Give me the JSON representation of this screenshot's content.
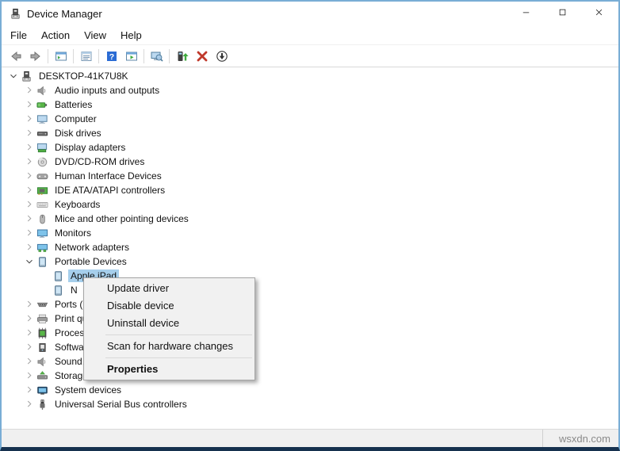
{
  "window": {
    "title": "Device Manager",
    "controls": [
      {
        "name": "minimize",
        "icon": "minimize"
      },
      {
        "name": "maximize",
        "icon": "maximize"
      },
      {
        "name": "close",
        "icon": "close"
      }
    ]
  },
  "menu_bar": {
    "items": [
      "File",
      "Action",
      "View",
      "Help"
    ]
  },
  "toolbar": {
    "items": [
      {
        "type": "button",
        "icon": "back-arrow"
      },
      {
        "type": "button",
        "icon": "forward-arrow"
      },
      {
        "type": "separator"
      },
      {
        "type": "button",
        "icon": "console-tree"
      },
      {
        "type": "separator"
      },
      {
        "type": "button",
        "icon": "properties-window"
      },
      {
        "type": "separator"
      },
      {
        "type": "button",
        "icon": "help"
      },
      {
        "type": "button",
        "icon": "action-pane"
      },
      {
        "type": "separator"
      },
      {
        "type": "button",
        "icon": "scan-computer"
      },
      {
        "type": "separator"
      },
      {
        "type": "button",
        "icon": "update-driver"
      },
      {
        "type": "button",
        "icon": "uninstall-x"
      },
      {
        "type": "button",
        "icon": "disable-down"
      }
    ]
  },
  "tree": {
    "items": [
      {
        "label": "DESKTOP-41K7U8K",
        "icon": "device-manager",
        "level": 0,
        "expander": "expanded",
        "selected": false
      },
      {
        "label": "Audio inputs and outputs",
        "icon": "audio",
        "level": 1,
        "expander": "collapsed",
        "selected": false
      },
      {
        "label": "Batteries",
        "icon": "battery",
        "level": 1,
        "expander": "collapsed",
        "selected": false
      },
      {
        "label": "Computer",
        "icon": "computer",
        "level": 1,
        "expander": "collapsed",
        "selected": false
      },
      {
        "label": "Disk drives",
        "icon": "disk-drive",
        "level": 1,
        "expander": "collapsed",
        "selected": false
      },
      {
        "label": "Display adapters",
        "icon": "display-adapter",
        "level": 1,
        "expander": "collapsed",
        "selected": false
      },
      {
        "label": "DVD/CD-ROM drives",
        "icon": "dvd-drive",
        "level": 1,
        "expander": "collapsed",
        "selected": false
      },
      {
        "label": "Human Interface Devices",
        "icon": "hid",
        "level": 1,
        "expander": "collapsed",
        "selected": false
      },
      {
        "label": "IDE ATA/ATAPI controllers",
        "icon": "ide-controller",
        "level": 1,
        "expander": "collapsed",
        "selected": false
      },
      {
        "label": "Keyboards",
        "icon": "keyboard",
        "level": 1,
        "expander": "collapsed",
        "selected": false
      },
      {
        "label": "Mice and other pointing devices",
        "icon": "mouse",
        "level": 1,
        "expander": "collapsed",
        "selected": false
      },
      {
        "label": "Monitors",
        "icon": "monitor",
        "level": 1,
        "expander": "collapsed",
        "selected": false
      },
      {
        "label": "Network adapters",
        "icon": "network-adapter",
        "level": 1,
        "expander": "collapsed",
        "selected": false
      },
      {
        "label": "Portable Devices",
        "icon": "portable-device",
        "level": 1,
        "expander": "expanded",
        "selected": false
      },
      {
        "label": "Apple iPad",
        "icon": "portable-device",
        "level": 2,
        "expander": "none",
        "selected": true
      },
      {
        "label": "N",
        "icon": "portable-device",
        "level": 2,
        "expander": "none",
        "selected": false
      },
      {
        "label": "Ports (COM & LPT)",
        "icon": "serial-port",
        "level": 1,
        "expander": "collapsed",
        "selected": false
      },
      {
        "label": "Print queues",
        "icon": "printer",
        "level": 1,
        "expander": "collapsed",
        "selected": false
      },
      {
        "label": "Processors",
        "icon": "processor",
        "level": 1,
        "expander": "collapsed",
        "selected": false
      },
      {
        "label": "Software devices",
        "icon": "software-device",
        "level": 1,
        "expander": "collapsed",
        "selected": false
      },
      {
        "label": "Sound, video and game controllers",
        "icon": "sound",
        "level": 1,
        "expander": "collapsed",
        "selected": false
      },
      {
        "label": "Storage controllers",
        "icon": "storage-controller",
        "level": 1,
        "expander": "collapsed",
        "selected": false
      },
      {
        "label": "System devices",
        "icon": "system-device",
        "level": 1,
        "expander": "collapsed",
        "selected": false
      },
      {
        "label": "Universal Serial Bus controllers",
        "icon": "usb-controller",
        "level": 1,
        "expander": "collapsed",
        "selected": false
      }
    ]
  },
  "context_menu": {
    "items": [
      {
        "type": "item",
        "label": "Update driver",
        "bold": false
      },
      {
        "type": "item",
        "label": "Disable device",
        "bold": false
      },
      {
        "type": "item",
        "label": "Uninstall device",
        "bold": false
      },
      {
        "type": "separator"
      },
      {
        "type": "item",
        "label": "Scan for hardware changes",
        "bold": false
      },
      {
        "type": "separator"
      },
      {
        "type": "item",
        "label": "Properties",
        "bold": true
      }
    ]
  },
  "status_bar": {
    "watermark": "wsxdn.com"
  },
  "colors": {
    "selection_bg": "#a6cfec",
    "menu_bg": "#f1f1f1",
    "accent_border": "#79add5",
    "bottom_border": "#16314e"
  }
}
